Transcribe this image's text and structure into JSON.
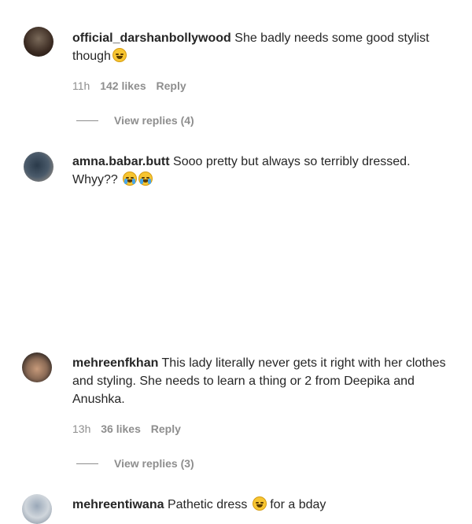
{
  "comments": [
    {
      "username": "official_darshanbollywood",
      "text": "She badly needs some good stylist though",
      "time": "11h",
      "likes": "142 likes",
      "reply_label": "Reply",
      "view_replies": "View replies (4)"
    },
    {
      "username": "amna.babar.butt",
      "text": "Sooo pretty but always so terribly dressed. Whyy??"
    },
    {
      "username": "mehreenfkhan",
      "text": "This lady literally never gets it right with her clothes and styling. She needs to learn a thing or 2 from Deepika and Anushka.",
      "time": "13h",
      "likes": "36 likes",
      "reply_label": "Reply",
      "view_replies": "View replies (3)"
    },
    {
      "username": "mehreentiwana",
      "text_before": "Pathetic dress",
      "text_after": "for a bday"
    }
  ]
}
